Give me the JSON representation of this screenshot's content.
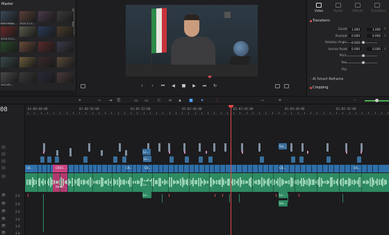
{
  "media_pool": {
    "title": "Master",
    "thumbnails": [
      {
        "label": "BB5VrBKbl...",
        "color": "#3a4a5a"
      },
      {
        "label": "2024-11-0...",
        "color": "#5a4038"
      },
      {
        "label": "",
        "color": "#4a3a4a"
      },
      {
        "label": "",
        "color": "#3a3a3a"
      },
      {
        "label": "2024-11-0...",
        "color": "#6a2a2a"
      },
      {
        "label": "",
        "color": "#5a5a4a"
      },
      {
        "label": "",
        "color": "#2a3a5a"
      },
      {
        "label": "",
        "color": "#4a3a2a"
      },
      {
        "label": "",
        "color": "#2a4a2a"
      },
      {
        "label": "",
        "color": "#6a4a3a"
      },
      {
        "label": "",
        "color": "#5a2a2a"
      },
      {
        "label": "",
        "color": "#3a3a4a"
      },
      {
        "label": "",
        "color": "#3a4a4a"
      },
      {
        "label": "",
        "color": "#6a5a3a"
      },
      {
        "label": "",
        "color": "#3a2a2a"
      },
      {
        "label": "",
        "color": "#5a4a3a"
      },
      {
        "label": "1e11#1...",
        "color": "#4a4a4a"
      },
      {
        "label": "",
        "color": "#3a3a3a"
      },
      {
        "label": "",
        "color": "#2a2a3a"
      },
      {
        "label": "",
        "color": "#4a3a3a"
      }
    ]
  },
  "viewer": {
    "transport": [
      "⏮",
      "◀",
      "■",
      "▶",
      "⏭",
      "↻"
    ]
  },
  "inspector": {
    "tabs": [
      {
        "label": "Video",
        "active": true
      },
      {
        "label": "Audio",
        "active": false
      },
      {
        "label": "Effects",
        "active": false
      },
      {
        "label": "Transition",
        "active": false
      }
    ],
    "transform_title": "Transform",
    "params": [
      {
        "name": "Zoom",
        "axis": "X",
        "value": "1.000",
        "y_label": "Y",
        "y_value": "1.000"
      },
      {
        "name": "Position",
        "axis": "X",
        "value": "0.000",
        "y_label": "Y",
        "y_value": "0.000"
      },
      {
        "name": "Rotation Angle",
        "axis": "",
        "value": "0.000",
        "slider": true
      },
      {
        "name": "Anchor Point",
        "axis": "X",
        "value": "0.000",
        "y_label": "Y",
        "y_value": "0.000"
      },
      {
        "name": "Pitch",
        "axis": "",
        "value": "",
        "slider": true
      },
      {
        "name": "Yaw",
        "axis": "",
        "value": "",
        "slider": true
      },
      {
        "name": "Flip",
        "axis": "",
        "value": ""
      }
    ],
    "smart_reframe_title": "AI Smart Reframe",
    "cropping_title": "Cropping"
  },
  "toolbar": {
    "accent": "#4ea3ff"
  },
  "timeline": {
    "timecode": "08",
    "ruler_labels": [
      "01:00:00:00",
      "01:00:56:00",
      "01:01:52:00",
      "01:02:48:00",
      "01:03:44:00",
      "01:04:40:00",
      "01:05:36:00",
      "01:06:32:00"
    ],
    "track_labels": [
      "V3",
      "V2",
      "V1",
      "A1",
      "A2",
      "A3",
      "A4",
      "A5",
      "A6"
    ],
    "audio_levels": [
      "2.0",
      "2.0",
      "2.0",
      "1.0",
      "1.0",
      "1.0"
    ],
    "clip_labels": {
      "v1": [
        "C8...",
        "C803...",
        "C8...",
        "C8...",
        "C8...",
        "C8..."
      ],
      "a1": [
        "Kewe..."
      ],
      "titles": [
        "Lo...",
        "Lo...",
        "Sm..."
      ],
      "lowers": [
        "Le...",
        "Le...",
        "Le...",
        "Sm..."
      ]
    }
  }
}
